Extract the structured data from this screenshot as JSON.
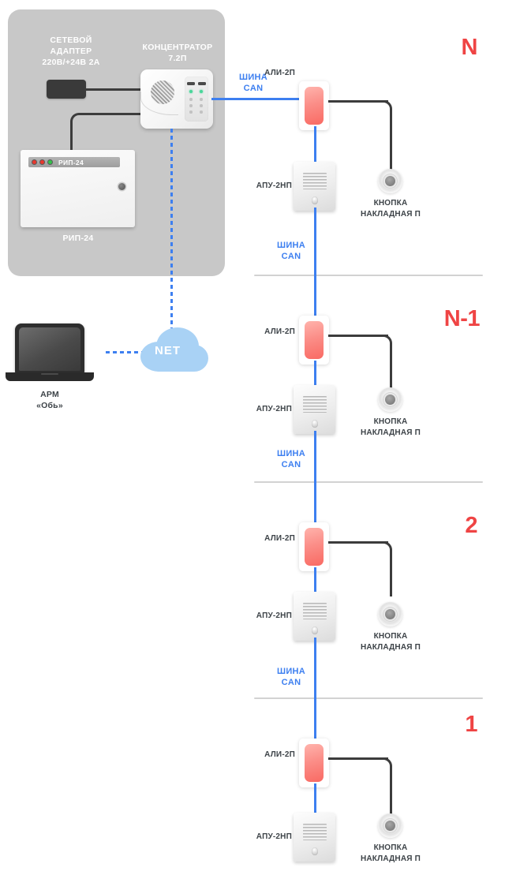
{
  "diagram": {
    "equipment_room": {
      "power_adapter": {
        "label": "СЕТЕВОЙ\nАДАПТЕР\n220В/+24В 2А",
        "icon": "power-adapter-icon"
      },
      "concentrator": {
        "label": "КОНЦЕНТРАТОР\n7.2П",
        "icon": "concentrator-icon"
      },
      "rip": {
        "label": "РИП-24",
        "strip_text": "РИП-24",
        "leds": [
          "red",
          "red",
          "green"
        ],
        "icon": "power-supply-icon"
      }
    },
    "workstation": {
      "label": "АРМ\n«Обь»",
      "icon": "laptop-icon"
    },
    "network": {
      "label": "NET",
      "icon": "cloud-icon"
    },
    "can_bus_label": "ШИНА\nCAN",
    "floors": [
      {
        "number": "N",
        "ali_label": "АЛИ-2П",
        "apu_label": "АПУ-2НП",
        "button_label": "КНОПКА\nНАКЛАДНАЯ П",
        "can_label_below": "ШИНА\nCAN",
        "has_separator_below": true
      },
      {
        "number": "N-1",
        "ali_label": "АЛИ-2П",
        "apu_label": "АПУ-2НП",
        "button_label": "КНОПКА\nНАКЛАДНАЯ П",
        "can_label_below": "ШИНА\nCAN",
        "has_separator_below": true
      },
      {
        "number": "2",
        "ali_label": "АЛИ-2П",
        "apu_label": "АПУ-2НП",
        "button_label": "КНОПКА\nНАКЛАДНАЯ П",
        "can_label_below": "ШИНА\nCAN",
        "has_separator_below": true
      },
      {
        "number": "1",
        "ali_label": "АЛИ-2П",
        "apu_label": "АПУ-2НП",
        "button_label": "КНОПКА\nНАКЛАДНАЯ П",
        "can_label_below": "",
        "has_separator_below": false
      }
    ],
    "colors": {
      "accent_red": "#ef4444",
      "bus_blue": "#3d7ff0",
      "panel_gray": "#c8c8c8",
      "module_red": "#f96a63",
      "cloud_blue": "#a9d2f5",
      "separator": "#d2d2d2"
    }
  }
}
